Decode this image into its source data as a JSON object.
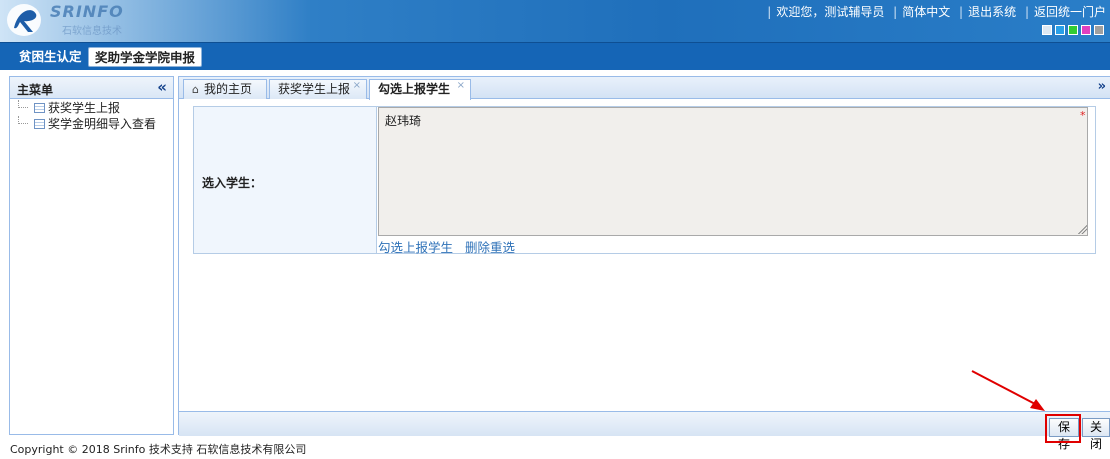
{
  "header": {
    "logo_text_en": "SRINFO",
    "logo_text_cn": "石软信息技术",
    "links": [
      "欢迎您，测试辅导员",
      "简体中文",
      "退出系统",
      "返回统一门户"
    ],
    "theme_swatches": [
      "#dde8f3",
      "#2aa0e8",
      "#33cc33",
      "#e040c0",
      "#a0a0a0"
    ]
  },
  "modules": [
    {
      "label": "贫困生认定",
      "active": false
    },
    {
      "label": "奖助学金学院申报",
      "active": true
    }
  ],
  "sidebar": {
    "title": "主菜单",
    "collapse_icon": "«",
    "items": [
      {
        "label": "获奖学生上报"
      },
      {
        "label": "奖学金明细导入查看"
      }
    ]
  },
  "tabs": [
    {
      "label": "我的主页",
      "closable": false
    },
    {
      "label": "获奖学生上报",
      "closable": true
    },
    {
      "label": "勾选上报学生",
      "closable": true,
      "active": true
    }
  ],
  "tab_scroll_icon": "»",
  "form": {
    "label": "选入学生：",
    "value": "赵玮琦",
    "required_mark": "*",
    "actions": [
      "勾选上报学生",
      "删除重选"
    ]
  },
  "buttons": {
    "save": "保存",
    "close": "关闭"
  },
  "footer": "Copyright © 2018 Srinfo 技术支持 石软信息技术有限公司",
  "colors": {
    "accent": "#1565b6",
    "highlight": "#e00000"
  }
}
